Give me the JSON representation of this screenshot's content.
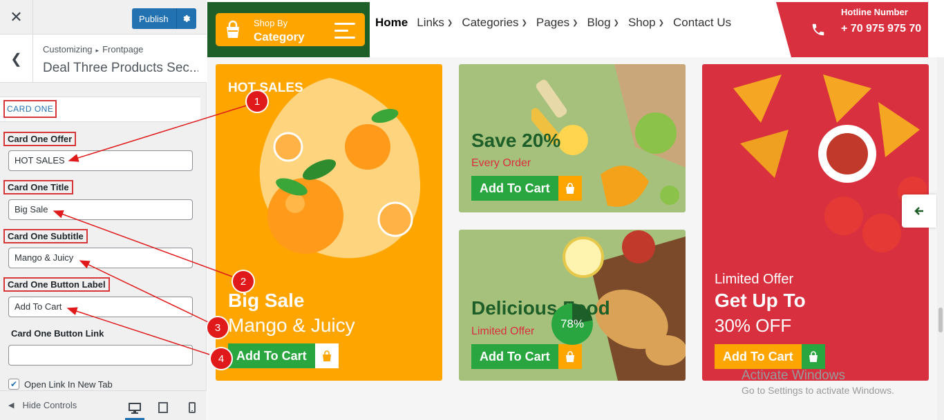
{
  "customizer": {
    "publish_label": "Publish",
    "breadcrumb_root": "Customizing",
    "breadcrumb_leaf": "Frontpage",
    "section_title": "Deal Three Products Sec...",
    "card_one_heading": "CARD ONE",
    "fields": {
      "offer_label": "Card One Offer",
      "offer_value": "HOT SALES",
      "title_label": "Card One Title",
      "title_value": "Big Sale",
      "subtitle_label": "Card One Subtitle",
      "subtitle_value": "Mango & Juicy",
      "button_label_label": "Card One Button Label",
      "button_label_value": "Add To Cart",
      "button_link_label": "Card One Button Link",
      "button_link_value": "",
      "new_tab_label": "Open Link In New Tab",
      "new_tab_checked": true
    },
    "hide_controls_label": "Hide Controls"
  },
  "header": {
    "shop_by_line1": "Shop By",
    "shop_by_line2": "Category",
    "nav": [
      "Home",
      "Links",
      "Categories",
      "Pages",
      "Blog",
      "Shop",
      "Contact Us"
    ],
    "hotline_label": "Hotline Number",
    "hotline_number": "+ 70 975 975 70"
  },
  "cards": {
    "card1": {
      "offer": "HOT SALES",
      "title": "Big Sale",
      "subtitle": "Mango & Juicy",
      "button": "Add To Cart"
    },
    "card2": {
      "title": "Save 20%",
      "subtitle": "Every Order",
      "button": "Add To Cart"
    },
    "card3": {
      "title": "Delicious Food",
      "subtitle": "Limited Offer",
      "button": "Add To Cart"
    },
    "card4": {
      "subtitle": "Limited Offer",
      "title": "Get Up To",
      "percent": "30% OFF",
      "button": "Add To Cart"
    }
  },
  "progress_badge": {
    "label": "78%",
    "value": 78
  },
  "markers": [
    "1",
    "2",
    "3",
    "4"
  ],
  "watermark": {
    "line1": "Activate Windows",
    "line2": "Go to Settings to activate Windows."
  },
  "colors": {
    "brand_green": "#1e5e28",
    "accent_orange": "#ffa500",
    "accent_red": "#d8303f",
    "button_green": "#2aa640",
    "wp_blue": "#2271b1",
    "annotation_red": "#e01a1a"
  },
  "icons": [
    "close-icon",
    "gear-icon",
    "chevron-left-icon",
    "shopping-bag-icon",
    "hamburger-icon",
    "chevron-down-icon",
    "phone-icon",
    "arrow-left-icon",
    "desktop-icon",
    "tablet-icon",
    "mobile-icon",
    "check-icon"
  ]
}
